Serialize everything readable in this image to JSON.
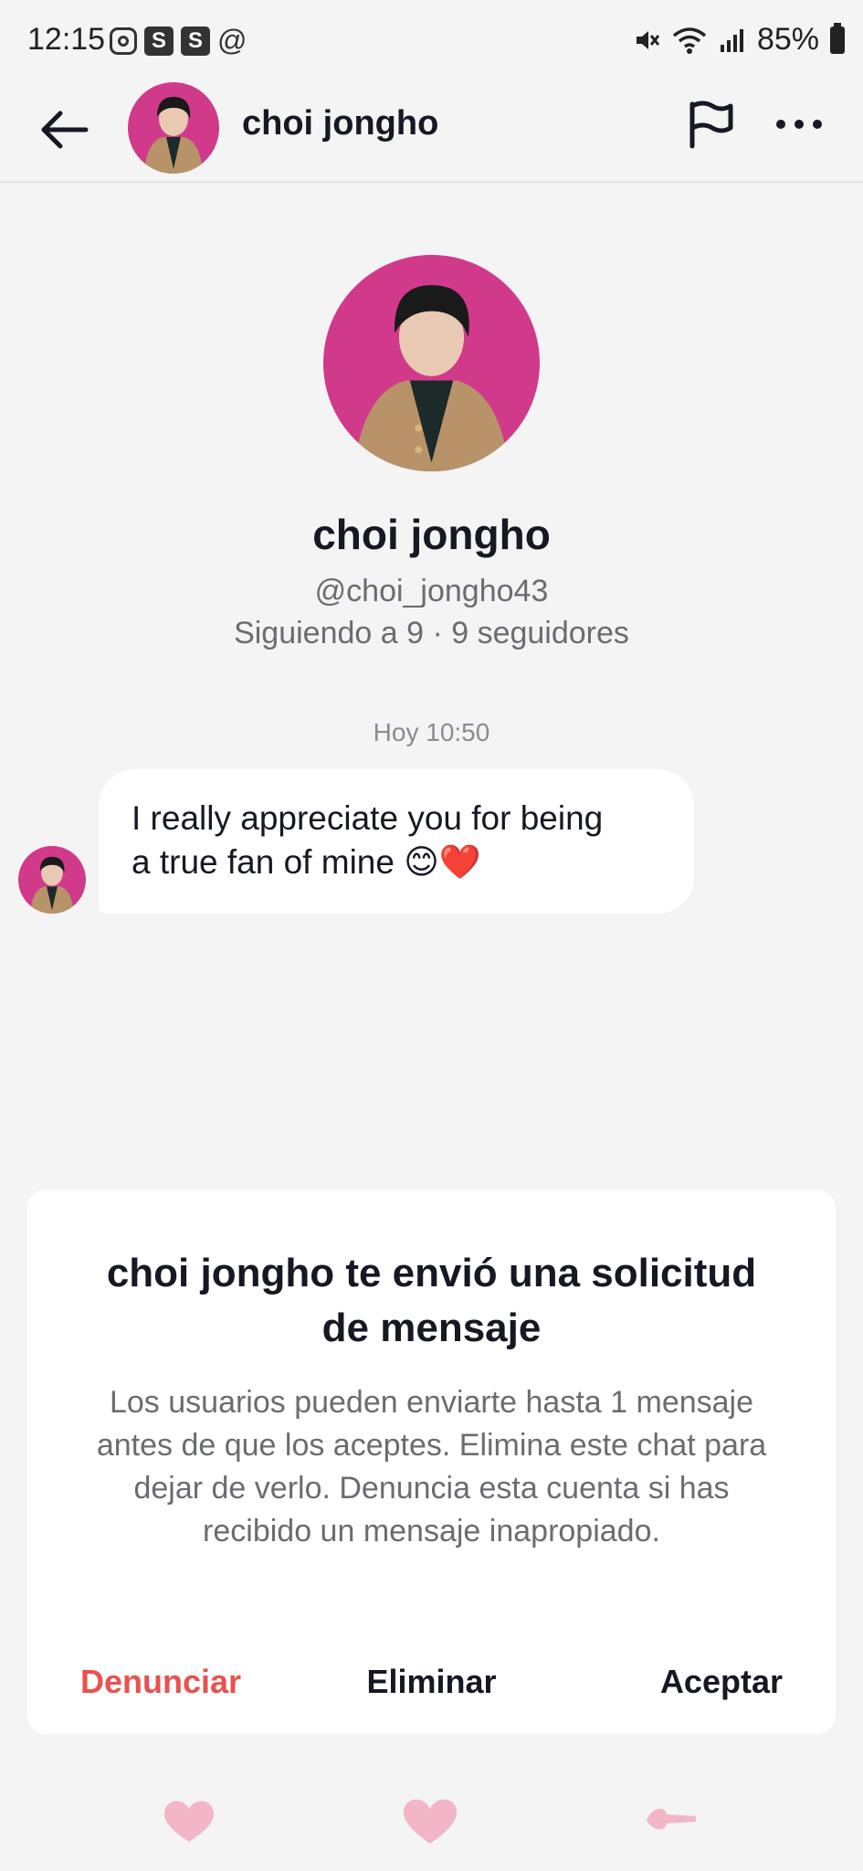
{
  "status_bar": {
    "time": "12:15",
    "left_icons": [
      "instagram-icon",
      "s-app-icon",
      "s-app-icon",
      "at-icon"
    ],
    "s_icon_label": "S",
    "at_label": "@",
    "battery": "85%",
    "right_icons": [
      "mute-icon",
      "wifi-icon",
      "signal-icon",
      "battery-icon"
    ]
  },
  "nav": {
    "title": "choi jongho",
    "icons": [
      "back-arrow-icon",
      "flag-icon",
      "more-icon"
    ]
  },
  "profile": {
    "name": "choi jongho",
    "handle": "@choi_jongho43",
    "stats": "Siguiendo a 9 · 9 seguidores"
  },
  "chat": {
    "timestamp": "Hoy 10:50",
    "message_line1": "I really appreciate you for being",
    "message_line2": "a true fan of mine 😊❤️"
  },
  "request": {
    "title": "choi jongho te envió una solicitud de mensaje",
    "body": "Los usuarios pueden enviarte hasta 1 mensaje antes de que los aceptes. Elimina este chat para dejar de verlo. Denuncia esta cuenta si has recibido un mensaje inapropiado.",
    "report_label": "Denunciar",
    "delete_label": "Eliminar",
    "accept_label": "Aceptar",
    "report_color": "#e8524f"
  },
  "decorations": [
    "heart-icon",
    "heart-icon",
    "arrow-heart-icon"
  ],
  "colors": {
    "background": "#f4f4f5",
    "avatar_bg": "#d13a8a",
    "deco_pink": "#f2b6c8"
  }
}
